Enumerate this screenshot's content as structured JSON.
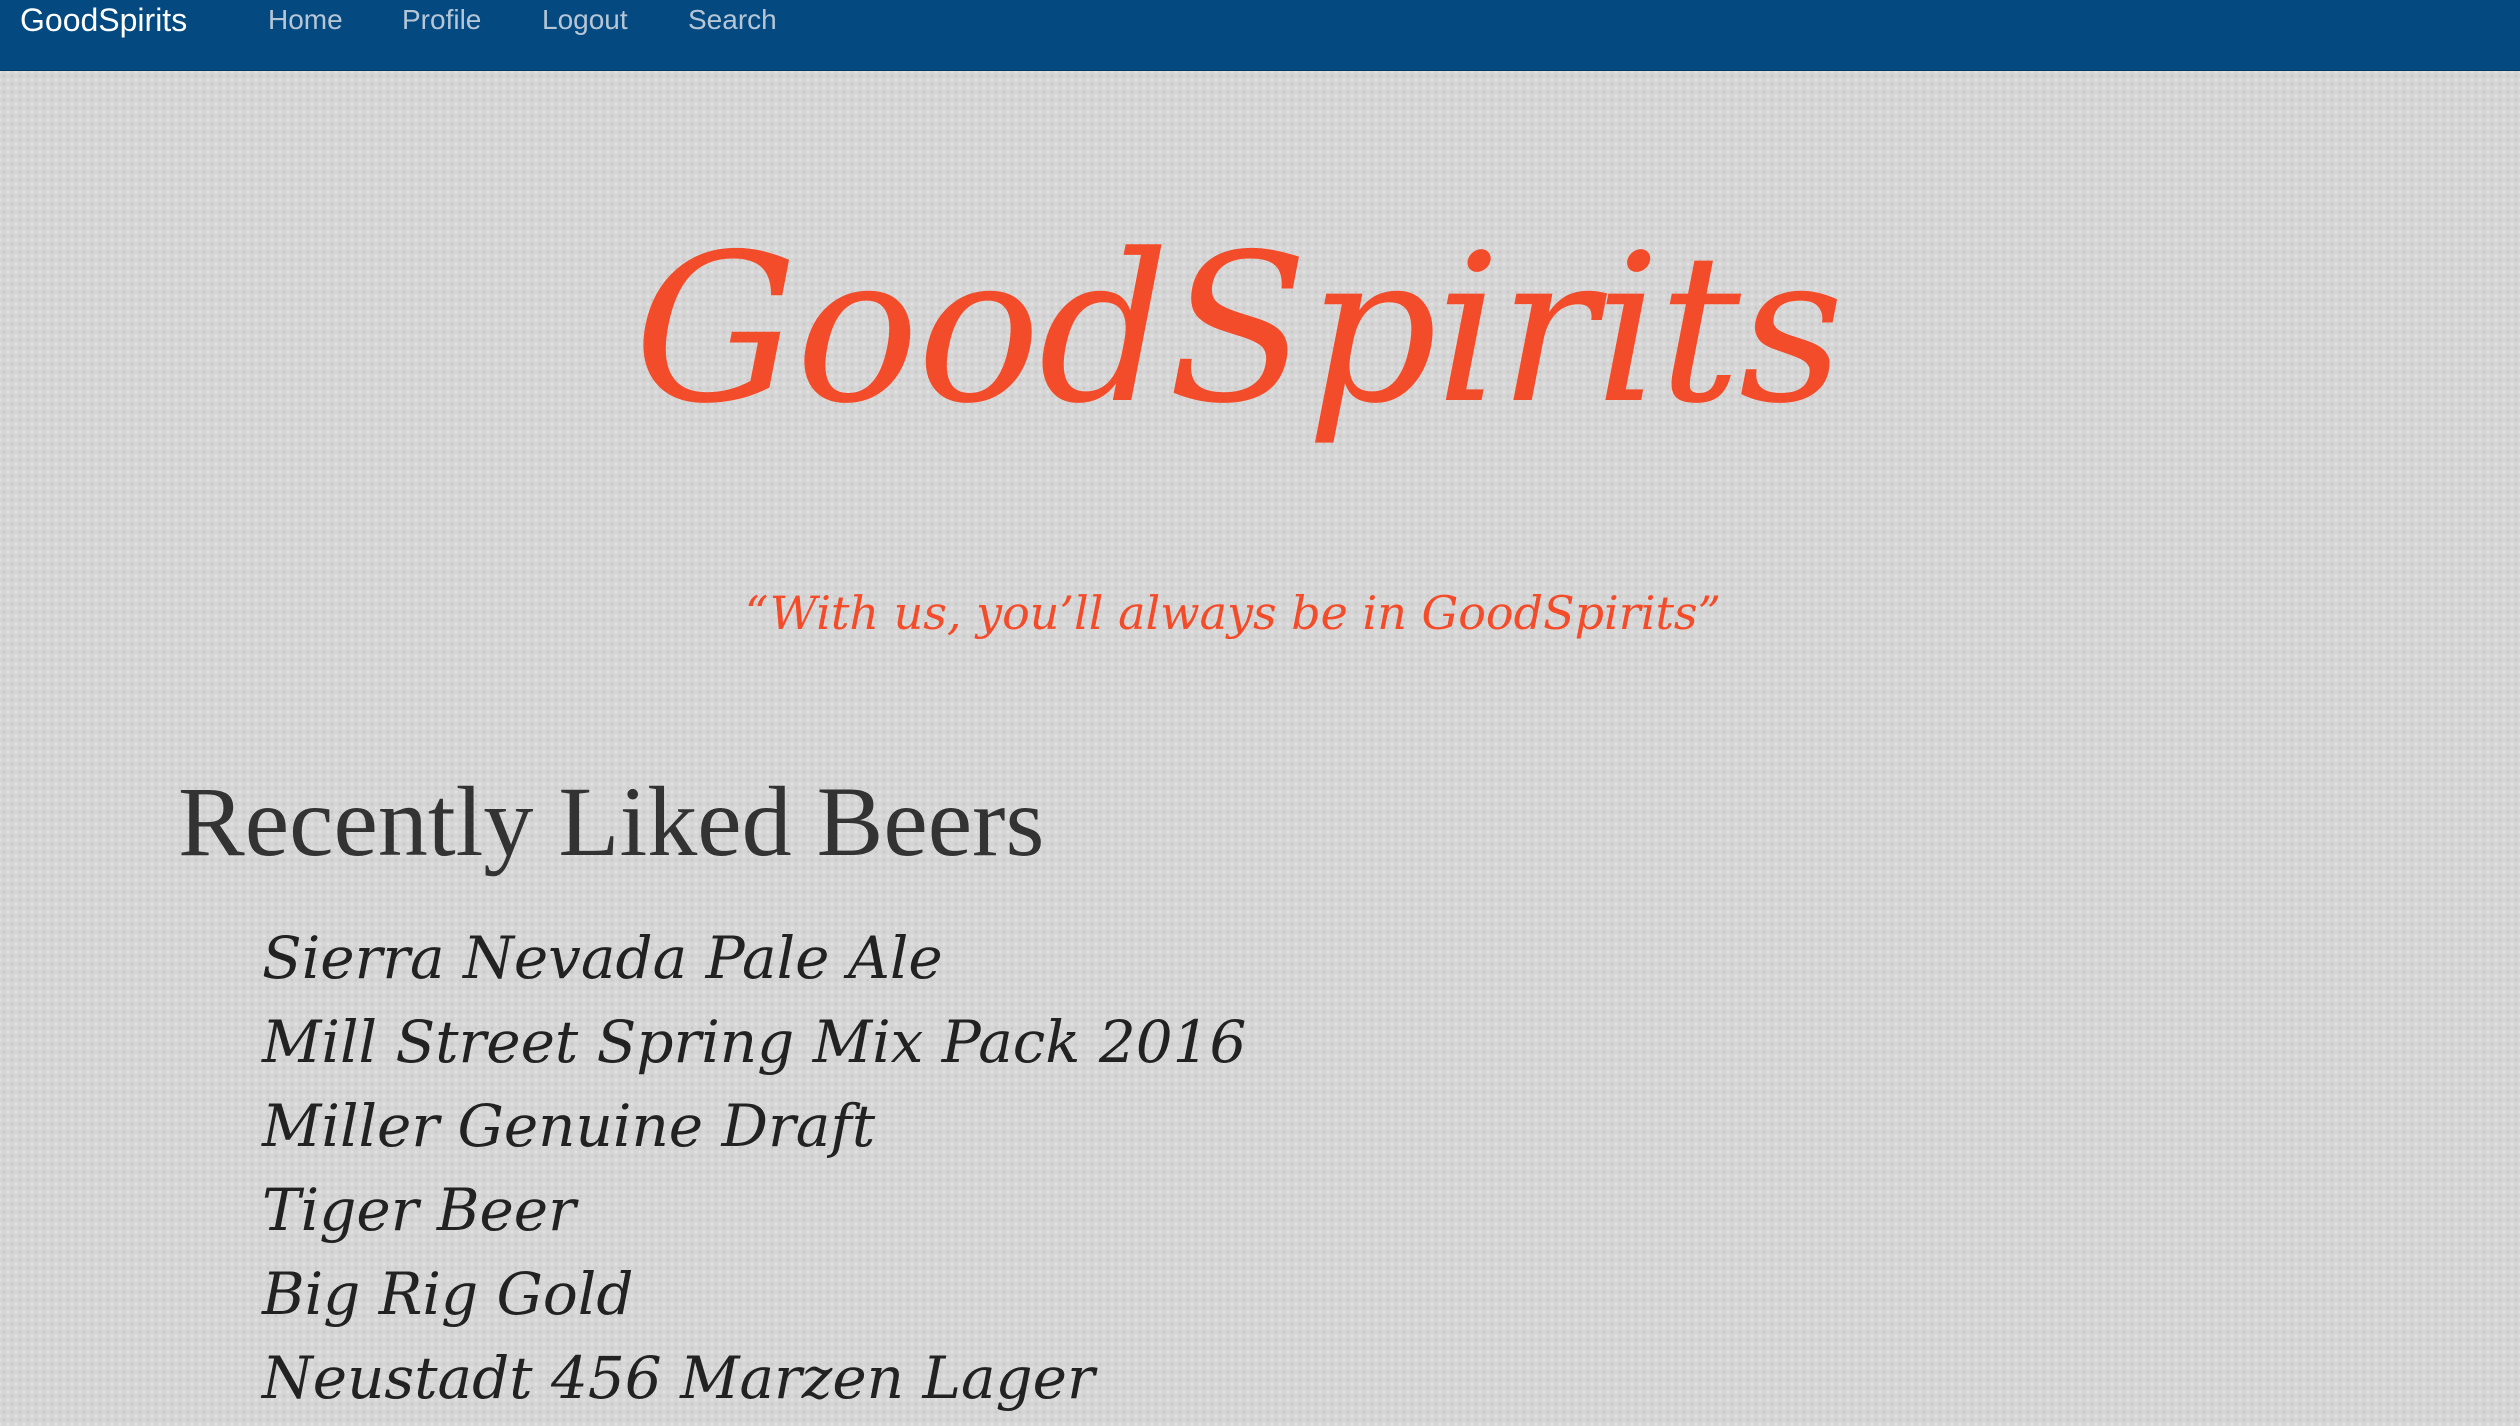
{
  "navbar": {
    "brand": "GoodSpirits",
    "items": [
      {
        "label": "Home"
      },
      {
        "label": "Profile"
      },
      {
        "label": "Logout"
      },
      {
        "label": "Search"
      }
    ]
  },
  "hero": {
    "title": "GoodSpirits",
    "tagline": "“With us, you’ll always be in GoodSpirits”"
  },
  "recent": {
    "heading": "Recently Liked Beers",
    "beers": [
      "Sierra Nevada Pale Ale",
      "Mill Street Spring Mix Pack 2016",
      "Miller Genuine Draft",
      "Tiger Beer",
      "Big Rig Gold",
      "Neustadt 456 Marzen Lager"
    ]
  },
  "colors": {
    "navbar_bg": "#044a80",
    "accent": "#f34c2a",
    "nav_text": "#b6c6d6",
    "page_bg": "#d6d6d6",
    "heading_text": "#333333"
  }
}
